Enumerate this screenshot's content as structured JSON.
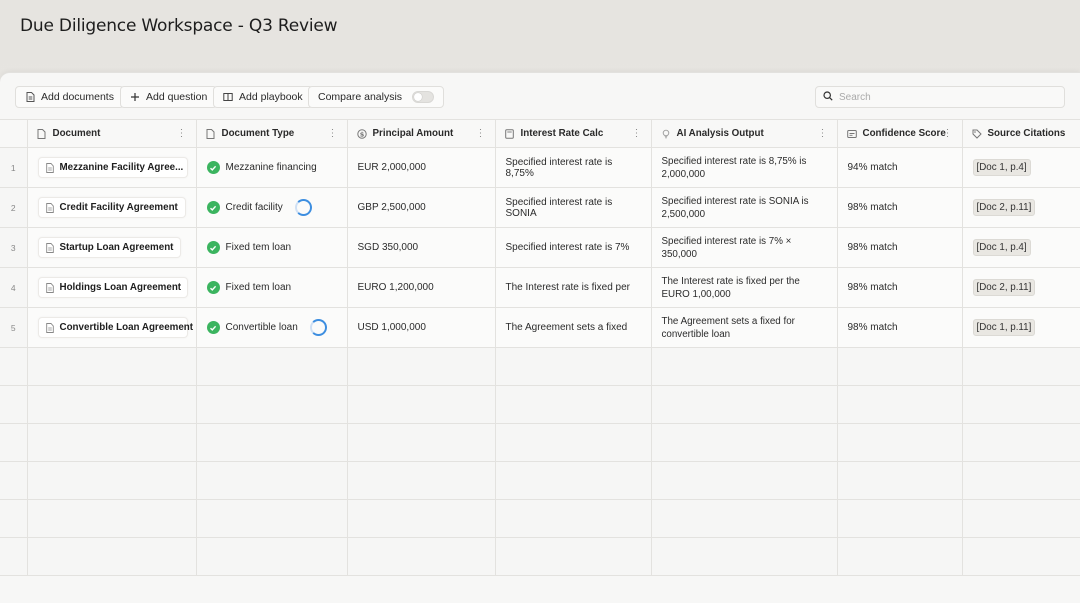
{
  "app": {
    "title": "Due Diligence Workspace - Q3 Review"
  },
  "toolbar": {
    "add_documents": "Add documents",
    "add_question": "Add question",
    "add_playbook": "Add playbook",
    "compare_analysis": "Compare analysis",
    "compare_enabled": false
  },
  "search": {
    "placeholder": "Search",
    "value": ""
  },
  "columns": [
    {
      "label": "Document",
      "icon": "file-icon"
    },
    {
      "label": "Document Type",
      "icon": "file-icon"
    },
    {
      "label": "Principal Amount",
      "icon": "dollar-circle-icon"
    },
    {
      "label": "Interest Rate Calc",
      "icon": "calculator-icon"
    },
    {
      "label": "AI Analysis Output",
      "icon": "lightbulb-icon"
    },
    {
      "label": "Confidence Score",
      "icon": "gauge-icon"
    },
    {
      "label": "Source Citations",
      "icon": "tag-icon"
    }
  ],
  "rows": [
    {
      "num": "1",
      "document": "Mezzanine Facility Agree...",
      "type": "Mezzanine financing",
      "loading": false,
      "principal": "EUR 2,000,000",
      "interest": "Specified interest rate is 8,75%",
      "ai": "Specified interest rate is 8,75% is 2,000,000",
      "confidence": "94% match",
      "citation": "[Doc 1, p.4]"
    },
    {
      "num": "2",
      "document": "Credit Facility Agreement",
      "type": "Credit facility",
      "loading": true,
      "principal": "GBP 2,500,000",
      "interest": "Specified interest rate is SONIA",
      "ai": "Specified interest rate is SONIA is 2,500,000",
      "confidence": "98% match",
      "citation": "[Doc 2, p.11]"
    },
    {
      "num": "3",
      "document": "Startup Loan Agreement",
      "type": "Fixed tem loan",
      "loading": false,
      "principal": "SGD 350,000",
      "interest": "Specified interest rate is 7%",
      "ai": "Specified interest rate is 7% × 350,000",
      "confidence": "98% match",
      "citation": "[Doc 1, p.4]"
    },
    {
      "num": "4",
      "document": "Holdings Loan Agreement",
      "type": "Fixed tem loan",
      "loading": false,
      "principal": "EURO 1,200,000",
      "interest": "The Interest rate is fixed per",
      "ai": "The Interest rate is fixed per the EURO 1,00,000",
      "confidence": "98% match",
      "citation": "[Doc 2, p.11]"
    },
    {
      "num": "5",
      "document": "Convertible Loan Agreement",
      "type": "Convertible loan",
      "loading": true,
      "principal": "USD 1,000,000",
      "interest": "The Agreement sets a fixed",
      "ai": "The Agreement sets a fixed for convertible loan",
      "confidence": "98% match",
      "citation": "[Doc 1, p.11]"
    }
  ],
  "colors": {
    "success": "#3bb45f",
    "spinner": "#3d8ee0",
    "citation_bg": "#e9e7e2"
  }
}
